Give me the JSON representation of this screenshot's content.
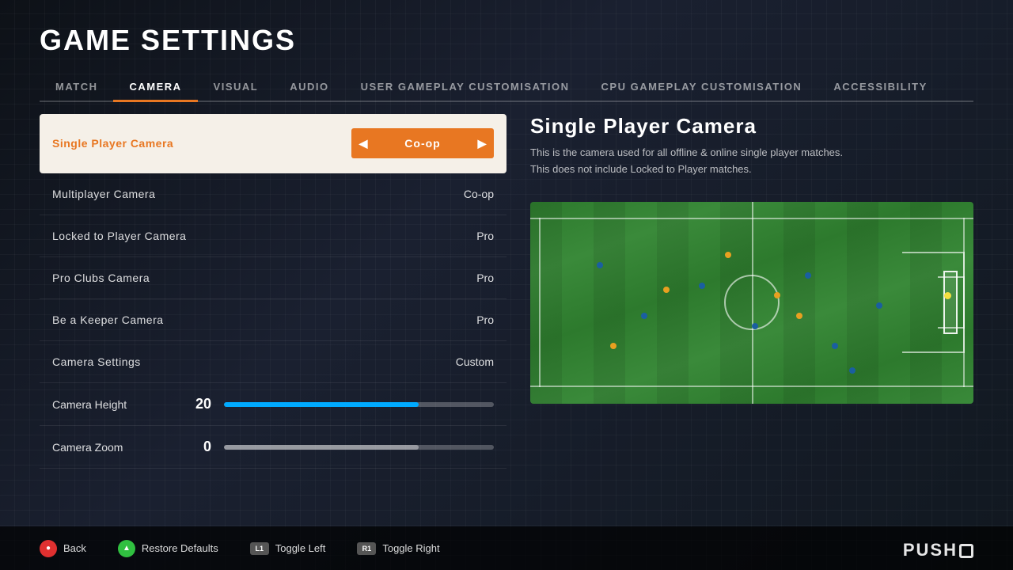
{
  "page": {
    "title": "GAME SETTINGS"
  },
  "tabs": [
    {
      "id": "match",
      "label": "MATCH",
      "active": false
    },
    {
      "id": "camera",
      "label": "CAMERA",
      "active": true
    },
    {
      "id": "visual",
      "label": "VISUAL",
      "active": false
    },
    {
      "id": "audio",
      "label": "AUDIO",
      "active": false
    },
    {
      "id": "user-gameplay",
      "label": "USER GAMEPLAY CUSTOMISATION",
      "active": false
    },
    {
      "id": "cpu-gameplay",
      "label": "CPU GAMEPLAY CUSTOMISATION",
      "active": false
    },
    {
      "id": "accessibility",
      "label": "ACCESSIBILITY",
      "active": false
    }
  ],
  "settings": [
    {
      "id": "single-player-camera",
      "label": "Single Player Camera",
      "value": "Co-op",
      "type": "selector",
      "active": true
    },
    {
      "id": "multiplayer-camera",
      "label": "Multiplayer Camera",
      "value": "Co-op",
      "type": "selector",
      "active": false
    },
    {
      "id": "locked-to-player-camera",
      "label": "Locked to Player Camera",
      "value": "Pro",
      "type": "selector",
      "active": false
    },
    {
      "id": "pro-clubs-camera",
      "label": "Pro Clubs Camera",
      "value": "Pro",
      "type": "selector",
      "active": false
    },
    {
      "id": "be-a-keeper-camera",
      "label": "Be a Keeper Camera",
      "value": "Pro",
      "type": "selector",
      "active": false
    },
    {
      "id": "camera-settings",
      "label": "Camera Settings",
      "value": "Custom",
      "type": "selector",
      "active": false
    }
  ],
  "sliders": [
    {
      "id": "camera-height",
      "label": "Camera Height",
      "value": 20,
      "fillPercent": 72,
      "color": "blue"
    },
    {
      "id": "camera-zoom",
      "label": "Camera Zoom",
      "value": 0,
      "fillPercent": 72,
      "color": "gray"
    }
  ],
  "info": {
    "title": "Single Player Camera",
    "description": "This is the camera used for all offline & online single player matches.\nThis does not include Locked to Player matches."
  },
  "bottom_actions": [
    {
      "id": "back",
      "button": "●",
      "button_type": "red",
      "label": "Back"
    },
    {
      "id": "restore",
      "button": "▲",
      "button_type": "green",
      "label": "Restore Defaults"
    },
    {
      "id": "toggle-left",
      "button": "L1",
      "button_type": "rect",
      "label": "Toggle Left"
    },
    {
      "id": "toggle-right",
      "button": "R1",
      "button_type": "rect",
      "label": "Toggle Right"
    }
  ],
  "brand": {
    "push_logo": "PUSH"
  }
}
